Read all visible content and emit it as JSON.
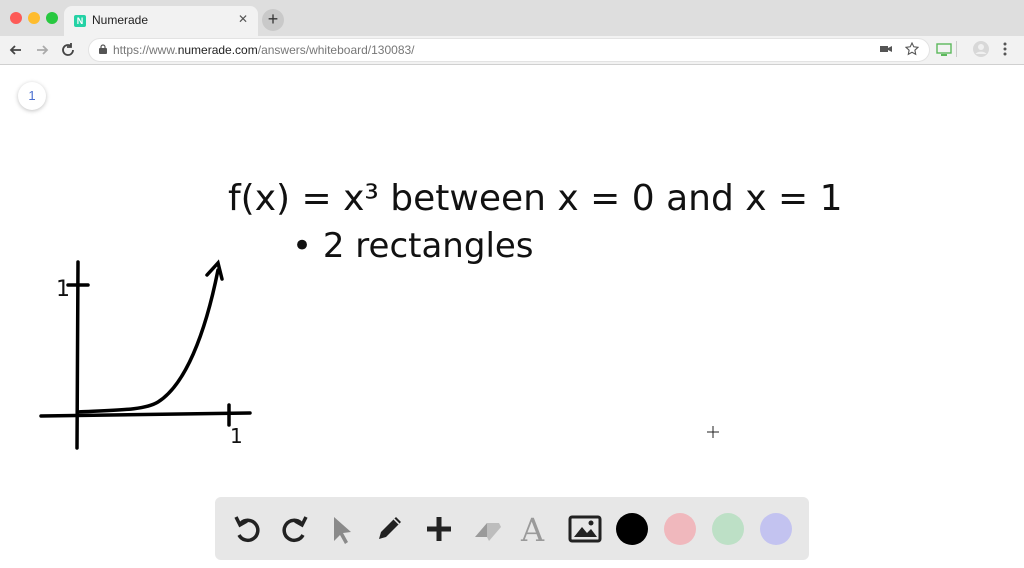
{
  "browser": {
    "tab_title": "Numerade",
    "tab_favicon": "N",
    "tab_close": "✕",
    "new_tab": "+",
    "url_prefix": "https://www.",
    "url_host": "numerade.com",
    "url_path": "/answers/whiteboard/130083/"
  },
  "page": {
    "page_number": "1"
  },
  "whiteboard": {
    "line1": "f(x) =  x³   between   x = 0  and  x = 1",
    "line2": "• 2 rectangles",
    "axis_y_label": "1",
    "axis_x_label": "1"
  },
  "toolbar": {
    "tools": [
      "undo-icon",
      "redo-icon",
      "select-icon",
      "pen-icon",
      "add-icon",
      "eraser-icon",
      "text-icon",
      "image-icon"
    ],
    "text_tool_glyph": "A",
    "colors": [
      "#000000",
      "#f0b8bd",
      "#bde0c6",
      "#c3c3f0"
    ]
  }
}
